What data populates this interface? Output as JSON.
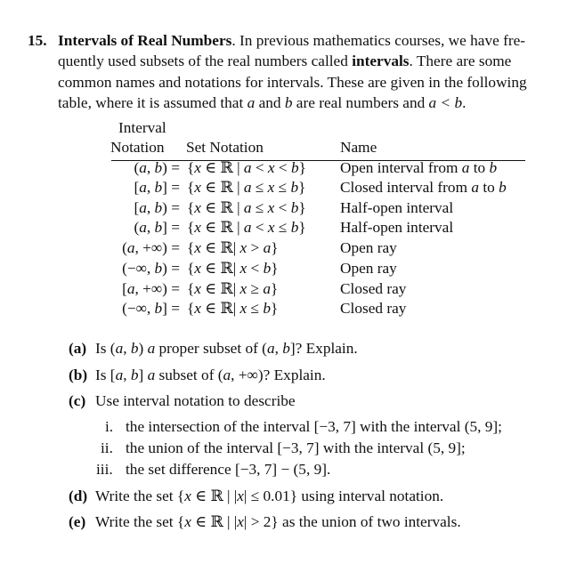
{
  "problem": {
    "number": "15.",
    "title": "Intervals of Real Numbers",
    "intro_lines": [
      {
        "pre": ". In previous mathematics courses, we have fre-"
      },
      {
        "pre": "quently used subsets of the real numbers called ",
        "bold": "intervals",
        "post": ". There are some"
      },
      {
        "pre": "common names and notations for intervals. These are given in the following"
      },
      {
        "pre": "table, where it is assumed that ",
        "m1": "a",
        "mid": " and ",
        "m2": "b",
        "post": " are real numbers and ",
        "m3": "a < b",
        "end": "."
      }
    ]
  },
  "table": {
    "headers": {
      "col1_line1": "Interval",
      "col1_line2": "Notation",
      "col2": "Set Notation",
      "col3": "Name"
    },
    "rows": [
      {
        "interval": "(a, b) =",
        "set": "{x ∈ ℝ | a < x < b}",
        "name": "Open interval from a to b"
      },
      {
        "interval": "[a, b] =",
        "set": "{x ∈ ℝ | a ≤ x ≤ b}",
        "name": "Closed interval from a to b"
      },
      {
        "interval": "[a, b) =",
        "set": "{x ∈ ℝ | a ≤ x < b}",
        "name": "Half-open interval"
      },
      {
        "interval": "(a, b] =",
        "set": "{x ∈ ℝ | a < x ≤ b}",
        "name": "Half-open interval"
      },
      {
        "interval": "(a, +∞) =",
        "set": "{x ∈ ℝ| x > a}",
        "name": "Open ray"
      },
      {
        "interval": "(−∞, b) =",
        "set": "{x ∈ ℝ| x < b}",
        "name": "Open ray"
      },
      {
        "interval": "[a, +∞) =",
        "set": "{x ∈ ℝ| x ≥ a}",
        "name": "Closed ray"
      },
      {
        "interval": "(−∞, b] =",
        "set": "{x ∈ ℝ| x ≤ b}",
        "name": "Closed ray"
      }
    ]
  },
  "questions": [
    {
      "label": "(a)",
      "text": "Is (a, b) a proper subset of (a, b]? Explain."
    },
    {
      "label": "(b)",
      "text": "Is [a, b] a subset of (a, +∞)? Explain."
    },
    {
      "label": "(c)",
      "text": "Use interval notation to describe"
    },
    {
      "label": "i.",
      "text": "the intersection of the interval [−3, 7] with the interval (5, 9];"
    },
    {
      "label": "ii.",
      "text": "the union of the interval [−3, 7] with the interval (5, 9];"
    },
    {
      "label": "iii.",
      "text": "the set difference [−3, 7] − (5, 9]."
    },
    {
      "label": "(d)",
      "text": "Write the set {x ∈ ℝ | |x| ≤ 0.01} using interval notation."
    },
    {
      "label": "(e)",
      "text": "Write the set {x ∈ ℝ | |x| > 2} as the union of two intervals."
    }
  ]
}
